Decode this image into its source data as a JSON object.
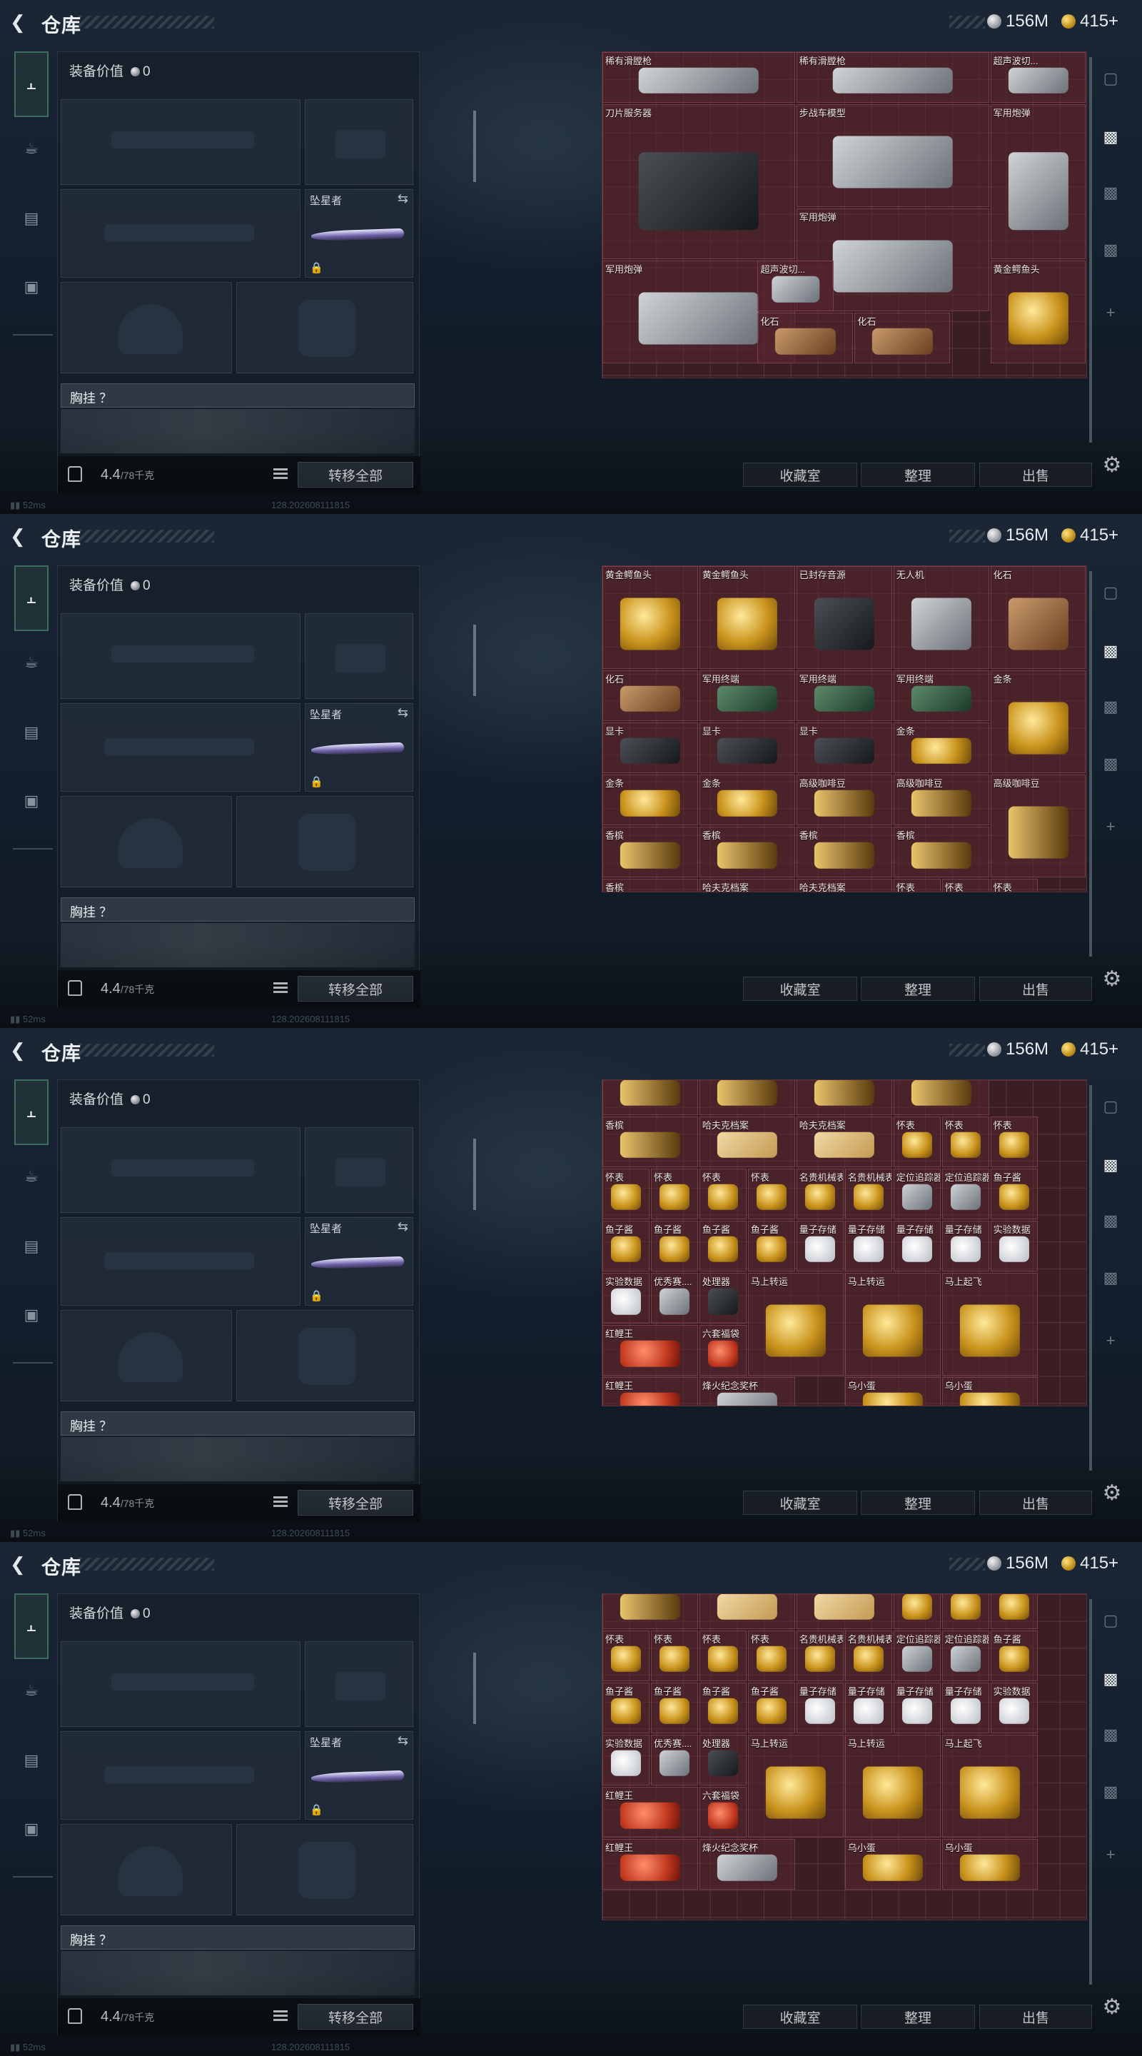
{
  "window": {
    "title": "仓库",
    "currency": [
      {
        "icon": "silver-coin-icon",
        "value": "156M"
      },
      {
        "icon": "gold-coin-icon",
        "value": "415+"
      }
    ],
    "status_text": "52ms",
    "version_text": "128.202608111815"
  },
  "equipment": {
    "value_label": "装备价值",
    "value_amount": "0",
    "melee_name": "坠星者",
    "chest_label": "胸挂 ？",
    "weight_value": "4.4",
    "weight_max": "/78千克",
    "transfer_all_label": "转移全部"
  },
  "stash_buttons": {
    "collection_label": "收藏室",
    "organize_label": "整理",
    "sell_label": "出售"
  },
  "nav_icons": [
    "pistol-icon",
    "helmet-icon",
    "vest-icon",
    "backpack-icon"
  ],
  "right_nav_icons": [
    "safe-icon",
    "stash-tab-icon-1",
    "stash-tab-icon-2",
    "stash-tab-icon-3",
    "add-tab-icon"
  ],
  "screens": [
    {
      "items": [
        {
          "name": "稀有滑膛枪",
          "art": "rifle"
        },
        {
          "name": "稀有滑膛枪",
          "art": "rifle"
        },
        {
          "name": "超声波切...",
          "art": "tool"
        },
        {
          "name": "刀片服务器",
          "art": "server"
        },
        {
          "name": "步战车模型",
          "art": "vehicle"
        },
        {
          "name": "军用炮弹",
          "art": "shell"
        },
        {
          "name": "军用炮弹",
          "art": "shell"
        },
        {
          "name": "军用炮弹",
          "art": "shell"
        },
        {
          "name": "超声波切...",
          "art": "tool"
        },
        {
          "name": "黄金鳄鱼头",
          "art": "gold-head"
        },
        {
          "name": "化石",
          "art": "fossil"
        },
        {
          "name": "化石",
          "art": "fossil"
        }
      ]
    },
    {
      "items": [
        {
          "name": "黄金鳄鱼头"
        },
        {
          "name": "黄金鳄鱼头"
        },
        {
          "name": "已封存音源"
        },
        {
          "name": "无人机"
        },
        {
          "name": "化石"
        },
        {
          "name": "化石"
        },
        {
          "name": "军用终端"
        },
        {
          "name": "军用终端"
        },
        {
          "name": "军用终端"
        },
        {
          "name": "金条"
        },
        {
          "name": "显卡"
        },
        {
          "name": "显卡"
        },
        {
          "name": "显卡"
        },
        {
          "name": "金条"
        },
        {
          "name": "金条"
        },
        {
          "name": "金条"
        },
        {
          "name": "高级咖啡豆"
        },
        {
          "name": "高级咖啡豆"
        },
        {
          "name": "高级咖啡豆"
        },
        {
          "name": "香槟"
        },
        {
          "name": "香槟"
        },
        {
          "name": "香槟"
        },
        {
          "name": "香槟"
        },
        {
          "name": "香槟"
        },
        {
          "name": "哈夫克档案"
        },
        {
          "name": "哈夫克档案"
        },
        {
          "name": "怀表"
        },
        {
          "name": "怀表"
        },
        {
          "name": "怀表"
        },
        {
          "name": "怀表"
        },
        {
          "name": "怀表"
        },
        {
          "name": "怀表"
        },
        {
          "name": "名贵机械表"
        },
        {
          "name": "定位追踪器"
        },
        {
          "name": "定位追踪器"
        },
        {
          "name": "鱼子酱"
        }
      ]
    },
    {
      "items": [
        {
          "name": "香槟"
        },
        {
          "name": "香槟"
        },
        {
          "name": "香槟"
        },
        {
          "name": "香槟"
        },
        {
          "name": "香槟"
        },
        {
          "name": "哈夫克档案"
        },
        {
          "name": "哈夫克档案"
        },
        {
          "name": "怀表"
        },
        {
          "name": "怀表"
        },
        {
          "name": "怀表"
        },
        {
          "name": "怀表"
        },
        {
          "name": "怀表"
        },
        {
          "name": "怀表"
        },
        {
          "name": "怀表"
        },
        {
          "name": "名贵机械表"
        },
        {
          "name": "名贵机械表"
        },
        {
          "name": "定位追踪器"
        },
        {
          "name": "定位追踪器"
        },
        {
          "name": "鱼子酱"
        },
        {
          "name": "鱼子酱"
        },
        {
          "name": "鱼子酱"
        },
        {
          "name": "鱼子酱"
        },
        {
          "name": "鱼子酱"
        },
        {
          "name": "量子存储"
        },
        {
          "name": "量子存储"
        },
        {
          "name": "量子存储"
        },
        {
          "name": "量子存储"
        },
        {
          "name": "实验数据"
        },
        {
          "name": "实验数据"
        },
        {
          "name": "优秀赛...."
        },
        {
          "name": "处理器"
        },
        {
          "name": "马上转运"
        },
        {
          "name": "马上转运"
        },
        {
          "name": "马上起飞"
        },
        {
          "name": "红鲤王"
        },
        {
          "name": "六套福袋"
        },
        {
          "name": "红鲤王"
        },
        {
          "name": "烽火纪念奖杯"
        },
        {
          "name": "乌小蛋"
        },
        {
          "name": "乌小蛋"
        }
      ]
    },
    {
      "items": [
        {
          "name": "香槟"
        },
        {
          "name": "哈夫克档案"
        },
        {
          "name": "哈夫克档案"
        },
        {
          "name": "怀表"
        },
        {
          "name": "怀表"
        },
        {
          "name": "怀表"
        },
        {
          "name": "怀表"
        },
        {
          "name": "怀表"
        },
        {
          "name": "怀表"
        },
        {
          "name": "怀表"
        },
        {
          "name": "名贵机械表"
        },
        {
          "name": "名贵机械表"
        },
        {
          "name": "定位追踪器"
        },
        {
          "name": "定位追踪器"
        },
        {
          "name": "鱼子酱"
        },
        {
          "name": "鱼子酱"
        },
        {
          "name": "鱼子酱"
        },
        {
          "name": "鱼子酱"
        },
        {
          "name": "鱼子酱"
        },
        {
          "name": "量子存储"
        },
        {
          "name": "量子存储"
        },
        {
          "name": "量子存储"
        },
        {
          "name": "量子存储"
        },
        {
          "name": "实验数据"
        },
        {
          "name": "实验数据"
        },
        {
          "name": "优秀赛...."
        },
        {
          "name": "处理器"
        },
        {
          "name": "马上转运"
        },
        {
          "name": "马上转运"
        },
        {
          "name": "马上起飞"
        },
        {
          "name": "红鲤王"
        },
        {
          "name": "六套福袋"
        },
        {
          "name": "红鲤王"
        },
        {
          "name": "烽火纪念奖杯"
        },
        {
          "name": "乌小蛋"
        },
        {
          "name": "乌小蛋"
        }
      ]
    }
  ]
}
